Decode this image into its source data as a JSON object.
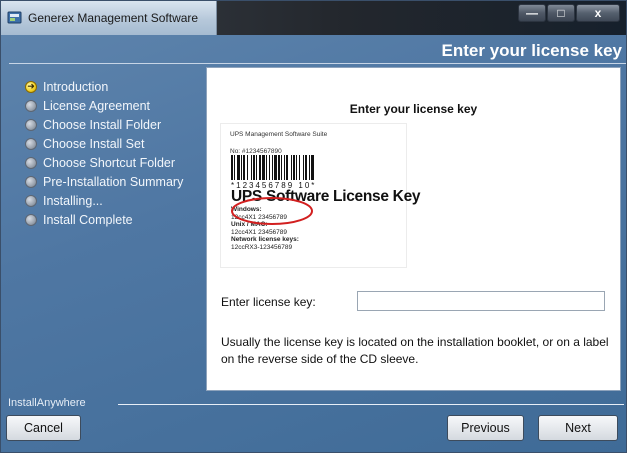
{
  "window": {
    "title": "Generex Management Software",
    "minimize": "—",
    "maximize": "□",
    "close": "x"
  },
  "header": {
    "title": "Enter your license key"
  },
  "steps": [
    {
      "label": "Introduction",
      "state": "current"
    },
    {
      "label": "License Agreement",
      "state": "pending"
    },
    {
      "label": "Choose Install Folder",
      "state": "pending"
    },
    {
      "label": "Choose Install Set",
      "state": "pending"
    },
    {
      "label": "Choose Shortcut Folder",
      "state": "pending"
    },
    {
      "label": "Pre-Installation Summary",
      "state": "pending"
    },
    {
      "label": "Installing...",
      "state": "pending"
    },
    {
      "label": "Install Complete",
      "state": "pending"
    }
  ],
  "panel": {
    "title": "Enter your license key",
    "card": {
      "header": "UPS Management Software Suite",
      "number": "No: #1234567890",
      "barcode_text": "*123456789 10*",
      "title": "UPS Software License Key",
      "windows_label": "Windows:",
      "windows_key": "12cc4X1 23456789",
      "unix_label": "Unix / MAC:",
      "unix_key": "12cc4X1 23456789",
      "network_label": "Network license keys:",
      "network_key": "12ccRX3-123456789"
    },
    "key_label": "Enter license key:",
    "key_value": "",
    "note": "Usually the license key is located on the installation booklet, or on a label on the reverse side of the CD sleeve."
  },
  "footer": {
    "brand": "InstallAnywhere",
    "cancel": "Cancel",
    "previous": "Previous",
    "next": "Next"
  },
  "colors": {
    "background": "#4f77a3",
    "highlight_circle": "#d21f1f",
    "current_step": "#f3d52a"
  }
}
